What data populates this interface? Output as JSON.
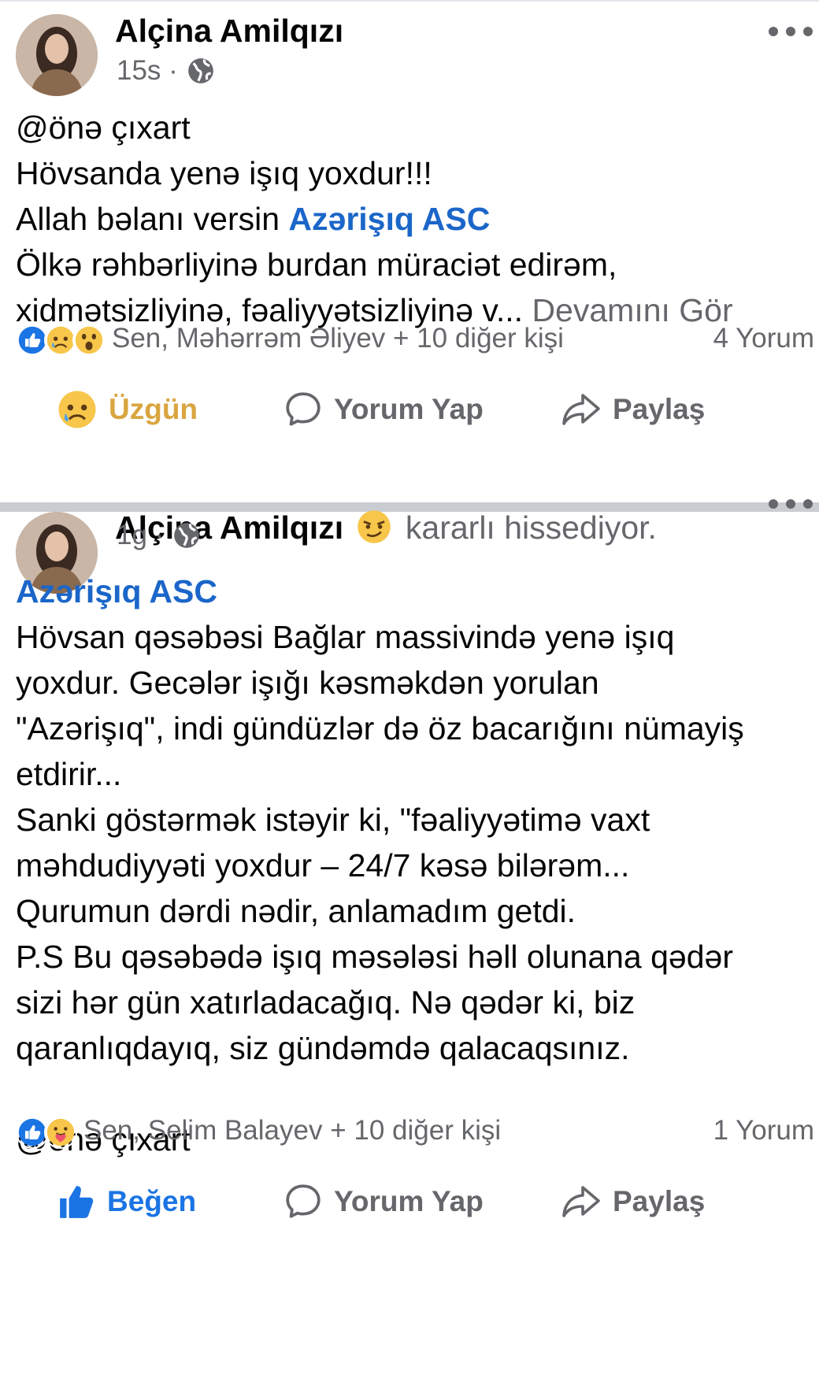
{
  "posts": [
    {
      "author": "Alçina Amilqızı",
      "feeling": "",
      "time": "15s",
      "text_lines": [
        "@önə çıxart",
        "Hövsanda yenə işıq yoxdur!!!",
        "Allah bəlanı versin "
      ],
      "mention": "Azərişıq ASC",
      "text_lines_2": [
        "Ölkə rəhbərliyinə burdan müraciət edirəm,",
        "xidmətsizliyinə, fəaliyyətsizliyinə v... "
      ],
      "see_more": "Devamını Gör",
      "reactions_text": "Sen, Məhərrəm Əliyev + 10 diğer kişi",
      "comments_count": "4 Yorum",
      "actions": {
        "react": "Üzgün",
        "comment": "Yorum Yap",
        "share": "Paylaş"
      }
    },
    {
      "author": "Alçina Amilqızı",
      "feeling": "kararlı hissediyor.",
      "time": "1g",
      "mention": "Azərişıq ASC",
      "text_lines": [
        "Hövsan qəsəbəsi Bağlar massivində yenə işıq",
        "yoxdur.  Gecələr işığı kəsməkdən yorulan",
        "\"Azərişıq\", indi gündüzlər də öz bacarığını nümayiş",
        "etdirir...",
        "Sanki göstərmək istəyir ki, \"fəaliyyətimə vaxt",
        "məhdudiyyəti yoxdur – 24/7 kəsə bilərəm...",
        "Qurumun dərdi nədir, anlamadım getdi.",
        "P.S Bu qəsəbədə işıq məsələsi həll olunana qədər",
        "sizi hər gün xatırladacağıq. Nə qədər ki, biz",
        "qaranlıqdayıq, siz gündəmdə qalacaqsınız."
      ],
      "tag_line": "@önə çıxart",
      "reactions_text": "Sen, Selim Balayev + 10 diğer kişi",
      "comments_count": "1 Yorum",
      "actions": {
        "react": "Beğen",
        "comment": "Yorum Yap",
        "share": "Paylaş"
      }
    }
  ],
  "icons": {
    "reaction_like": "like-reaction-icon",
    "reaction_sad": "sad-reaction-icon",
    "reaction_wow": "wow-reaction-icon",
    "reaction_care": "care-reaction-icon",
    "privacy": "globe-icon",
    "more": "more-options-icon",
    "comment": "comment-bubble-icon",
    "share": "share-arrow-icon",
    "feeling": "determined-emoji-icon"
  },
  "colors": {
    "link": "#1b66c9",
    "like_blue": "#1b74e4",
    "sad_yellow": "#d9a53f",
    "secondary_text": "#65676b",
    "separator": "#c9ccd1"
  }
}
